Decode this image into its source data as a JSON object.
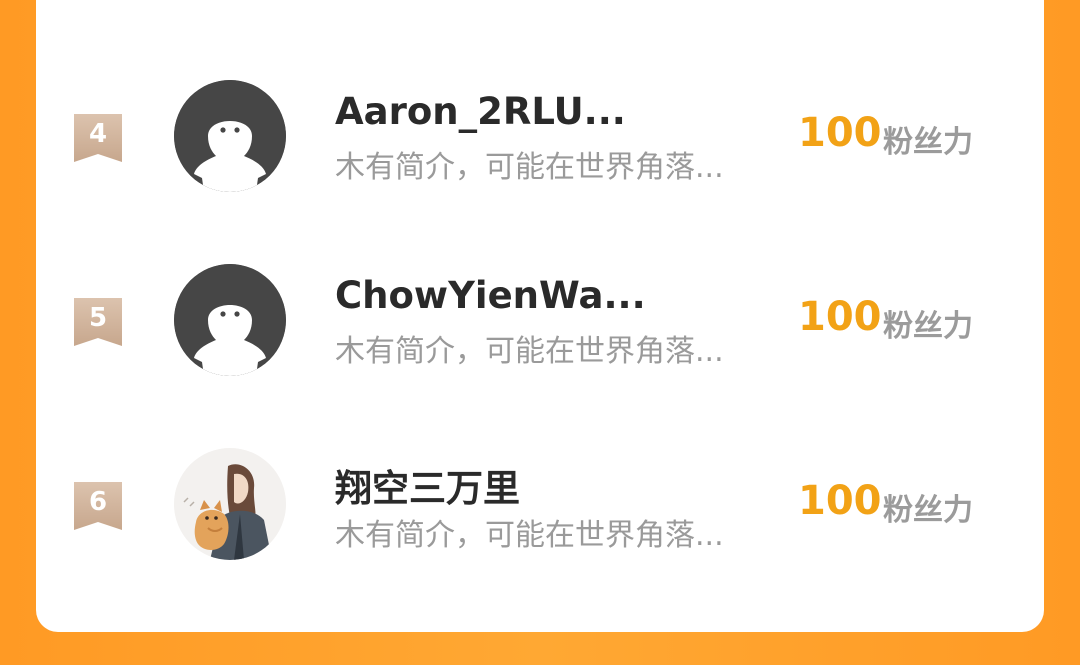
{
  "leaderboard": {
    "items": [
      {
        "rank": "4",
        "name": "Aaron_2RLU...",
        "intro": "木有简介，可能在世界角落...",
        "score": "100",
        "score_unit": "粉丝力",
        "avatar_type": "default"
      },
      {
        "rank": "5",
        "name": "ChowYienWa...",
        "intro": "木有简介，可能在世界角落...",
        "score": "100",
        "score_unit": "粉丝力",
        "avatar_type": "default"
      },
      {
        "rank": "6",
        "name": "翔空三万里",
        "intro": "木有简介，可能在世界角落...",
        "score": "100",
        "score_unit": "粉丝力",
        "avatar_type": "photo"
      }
    ]
  },
  "colors": {
    "background_orange": "#ffa126",
    "card": "#ffffff",
    "score": "#f2a216",
    "rank_badge": "#d3b6a0",
    "name_text": "#2a2a2a",
    "muted_text": "#9a9a9a"
  }
}
